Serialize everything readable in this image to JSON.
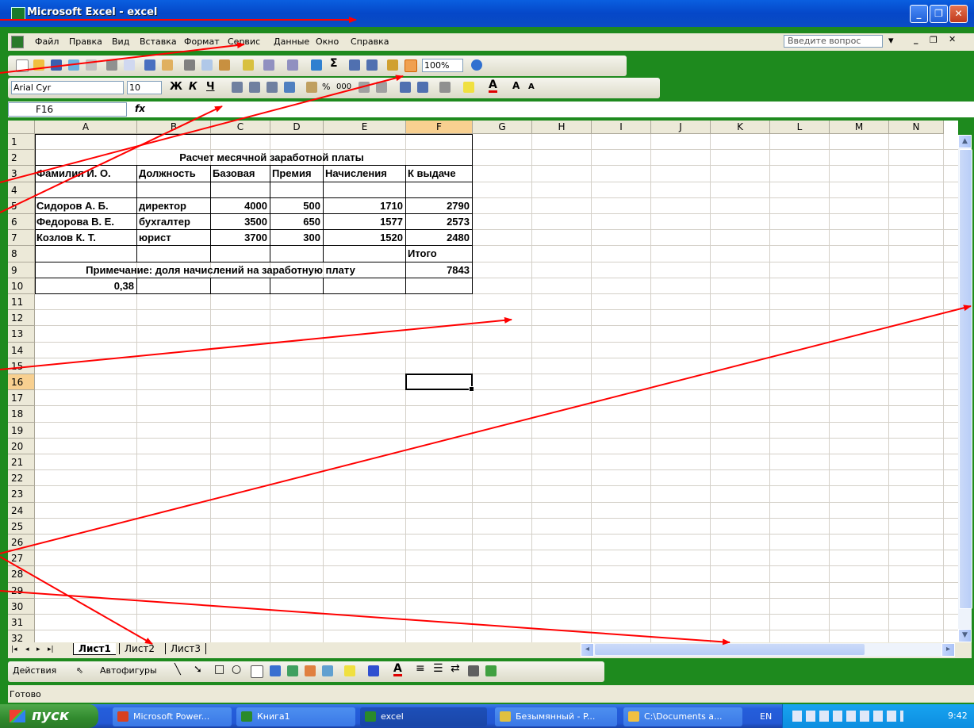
{
  "window": {
    "title": "Microsoft Excel - excel"
  },
  "menu": {
    "items": [
      "Файл",
      "Правка",
      "Вид",
      "Вставка",
      "Формат",
      "Сервис",
      "Данные",
      "Окно",
      "Справка"
    ],
    "question_placeholder": "Введите вопрос"
  },
  "toolbar": {
    "zoom": "100%",
    "font_name": "Arial Cyr",
    "font_size": "10",
    "bold": "Ж",
    "italic": "К",
    "underline": "Ч",
    "thousands": "000",
    "percent": "%",
    "sigma": "Σ"
  },
  "formula_bar": {
    "cell_ref": "F16",
    "fx": "fx",
    "content": ""
  },
  "grid": {
    "columns": [
      "A",
      "B",
      "C",
      "D",
      "E",
      "F",
      "G",
      "H",
      "I",
      "J",
      "K",
      "L",
      "M",
      "N"
    ],
    "rows": [
      "1",
      "2",
      "3",
      "4",
      "5",
      "6",
      "7",
      "8",
      "9",
      "10",
      "11",
      "12",
      "13",
      "14",
      "15",
      "16",
      "17",
      "18",
      "19",
      "20",
      "21",
      "22",
      "23",
      "24",
      "25",
      "26",
      "27",
      "28",
      "29",
      "30",
      "31",
      "32"
    ],
    "selected_cell": "F16"
  },
  "sheet": {
    "title": "Расчет месячной заработной платы",
    "headers": [
      "Фамилия И. О.",
      "Должность",
      "Базовая",
      "Премия",
      "Начисления",
      "К выдаче"
    ],
    "rows": [
      [
        "Сидоров А. Б.",
        "директор",
        "4000",
        "500",
        "1710",
        "2790"
      ],
      [
        "Федорова В. Е.",
        "бухгалтер",
        "3500",
        "650",
        "1577",
        "2573"
      ],
      [
        "Козлов К. Т.",
        "юрист",
        "3700",
        "300",
        "1520",
        "2480"
      ]
    ],
    "total_label": "Итого",
    "note": "Примечание: доля начислений на заработную плату",
    "total_value": "7843",
    "share": "0,38"
  },
  "sheet_tabs": [
    "Лист1",
    "Лист2",
    "Лист3"
  ],
  "draw_toolbar": {
    "actions": "Действия",
    "autoshapes": "Автофигуры"
  },
  "status": {
    "text": "Готово"
  },
  "taskbar": {
    "start": "пуск",
    "items": [
      "Microsoft Power...",
      "Книга1",
      "excel",
      "Безымянный - P...",
      "C:\\Documents a..."
    ],
    "lang": "EN",
    "time": "9:42"
  },
  "colors": {
    "title_bar": "#0a5fe0",
    "arrow": "#ff0000",
    "desktop": "#1e8a1e"
  }
}
